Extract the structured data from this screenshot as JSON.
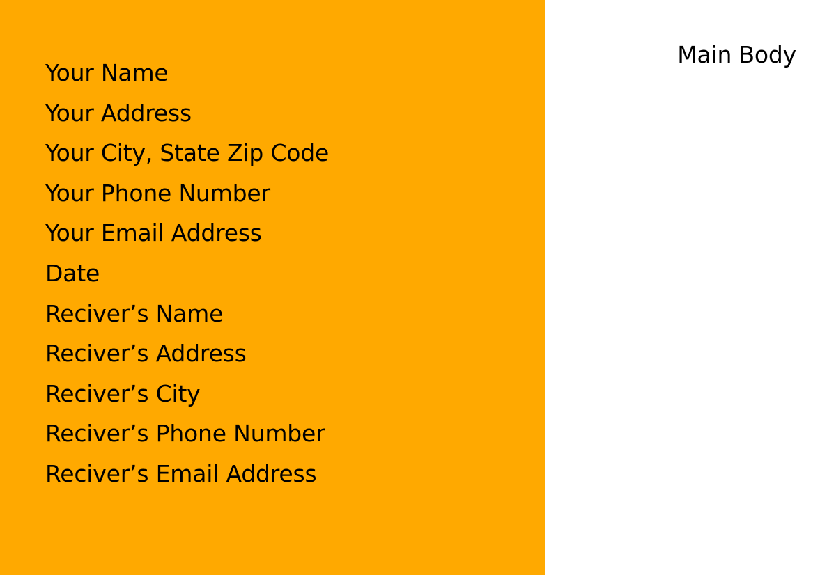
{
  "sender": {
    "name": "Your Name",
    "address": "Your Address",
    "city_state_zip": "Your City, State Zip Code",
    "phone": "Your Phone Number",
    "email": "Your Email Address"
  },
  "date": "Date",
  "receiver": {
    "name": "Reciver’s Name",
    "address": "Reciver’s Address",
    "city": "Reciver’s City",
    "phone": "Reciver’s Phone Number",
    "email": "Reciver’s Email Address"
  },
  "main_body": "Main Body",
  "colors": {
    "panel": "#FFA900",
    "background": "#FFFFFF",
    "text": "#000000"
  }
}
